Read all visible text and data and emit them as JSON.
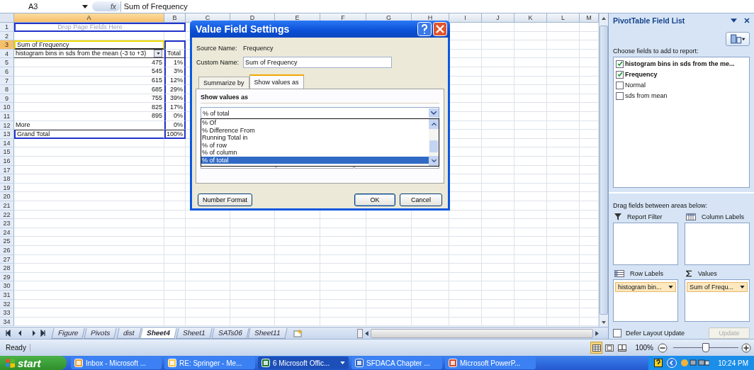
{
  "formula_bar": {
    "name_box": "A3",
    "fx_label": "fx",
    "formula": "Sum of Frequency"
  },
  "sheet": {
    "columns": [
      {
        "label": "A",
        "selected": true
      },
      {
        "label": "B",
        "selected": false
      },
      {
        "label": "C",
        "selected": false
      },
      {
        "label": "D",
        "selected": false
      },
      {
        "label": "E",
        "selected": false
      },
      {
        "label": "F",
        "selected": false
      },
      {
        "label": "G",
        "selected": false
      },
      {
        "label": "H",
        "selected": false
      },
      {
        "label": "I",
        "selected": false
      },
      {
        "label": "J",
        "selected": false
      },
      {
        "label": "K",
        "selected": false
      },
      {
        "label": "L",
        "selected": false
      },
      {
        "label": "M",
        "selected": false
      }
    ],
    "rows": [
      {
        "label": "1",
        "selected": false
      },
      {
        "label": "2",
        "selected": false
      },
      {
        "label": "3",
        "selected": true
      },
      {
        "label": "4",
        "selected": false
      },
      {
        "label": "5",
        "selected": false
      },
      {
        "label": "6",
        "selected": false
      },
      {
        "label": "7",
        "selected": false
      },
      {
        "label": "8",
        "selected": false
      },
      {
        "label": "9",
        "selected": false
      },
      {
        "label": "10",
        "selected": false
      },
      {
        "label": "11",
        "selected": false
      },
      {
        "label": "12",
        "selected": false
      },
      {
        "label": "13",
        "selected": false
      },
      {
        "label": "14",
        "selected": false
      },
      {
        "label": "15",
        "selected": false
      },
      {
        "label": "16",
        "selected": false
      },
      {
        "label": "17",
        "selected": false
      },
      {
        "label": "18",
        "selected": false
      },
      {
        "label": "19",
        "selected": false
      },
      {
        "label": "20",
        "selected": false
      },
      {
        "label": "21",
        "selected": false
      },
      {
        "label": "22",
        "selected": false
      },
      {
        "label": "23",
        "selected": false
      },
      {
        "label": "24",
        "selected": false
      },
      {
        "label": "25",
        "selected": false
      },
      {
        "label": "26",
        "selected": false
      },
      {
        "label": "27",
        "selected": false
      },
      {
        "label": "28",
        "selected": false
      },
      {
        "label": "29",
        "selected": false
      },
      {
        "label": "30",
        "selected": false
      },
      {
        "label": "31",
        "selected": false
      },
      {
        "label": "32",
        "selected": false
      },
      {
        "label": "33",
        "selected": false
      },
      {
        "label": "34",
        "selected": false
      }
    ]
  },
  "pivot": {
    "drop_zone": "Drop Page Fields Here",
    "data_field": "Sum of Frequency",
    "row_field": "histogram bins in sds from the mean (-3 to +3)",
    "total_header": "Total",
    "rows": [
      {
        "label": "475",
        "value": "1%",
        "kind": "number"
      },
      {
        "label": "545",
        "value": "3%",
        "kind": "number"
      },
      {
        "label": "615",
        "value": "12%",
        "kind": "number"
      },
      {
        "label": "685",
        "value": "29%",
        "kind": "number"
      },
      {
        "label": "755",
        "value": "39%",
        "kind": "number"
      },
      {
        "label": "825",
        "value": "17%",
        "kind": "number"
      },
      {
        "label": "895",
        "value": "0%",
        "kind": "number"
      },
      {
        "label": "More",
        "value": "0%",
        "kind": "text"
      }
    ],
    "grand_total": {
      "label": "Grand Total",
      "value": "100%"
    }
  },
  "sheet_tabs": [
    {
      "label": "Figure",
      "selected": false
    },
    {
      "label": "Pivots",
      "selected": false
    },
    {
      "label": "dist",
      "selected": false
    },
    {
      "label": "Sheet4",
      "selected": true
    },
    {
      "label": "Sheet1",
      "selected": false
    },
    {
      "label": "SATs06",
      "selected": false
    },
    {
      "label": "Sheet11",
      "selected": false
    }
  ],
  "dialog": {
    "title": "Value Field Settings",
    "source_label": "Source Name:",
    "source_value": "Frequency",
    "custom_label": "Custom Name:",
    "custom_value": "Sum of Frequency",
    "tabs": [
      {
        "label": "Summarize by",
        "selected": false
      },
      {
        "label": "Show values as",
        "selected": true
      }
    ],
    "section_title": "Show values as",
    "dropdown": {
      "value": "% of total",
      "expanded": true,
      "options": [
        {
          "label": "% Of",
          "selected": false
        },
        {
          "label": "% Difference From",
          "selected": false
        },
        {
          "label": "Running Total in",
          "selected": false
        },
        {
          "label": "% of row",
          "selected": false
        },
        {
          "label": "% of column",
          "selected": false
        },
        {
          "label": "% of total",
          "selected": true
        }
      ]
    },
    "buttons": [
      {
        "label": "Number Format",
        "kind": "secondary"
      },
      {
        "label": "OK",
        "kind": "default"
      },
      {
        "label": "Cancel",
        "kind": "secondary"
      }
    ]
  },
  "field_list": {
    "title": "PivotTable Field List",
    "choose_label": "Choose fields to add to report:",
    "fields": [
      {
        "label": "histogram bins in sds from the me...",
        "checked": true
      },
      {
        "label": "Frequency",
        "checked": true
      },
      {
        "label": "Normal",
        "checked": false
      },
      {
        "label": "sds from mean",
        "checked": false
      }
    ],
    "drag_label": "Drag fields between areas below:",
    "areas": [
      {
        "label": "Report Filter",
        "kind": "filter"
      },
      {
        "label": "Column Labels",
        "kind": "columns"
      },
      {
        "label": "Row Labels",
        "kind": "rows",
        "item": "histogram bin..."
      },
      {
        "label": "Values",
        "kind": "values",
        "item": "Sum of Frequ..."
      }
    ],
    "defer_update": {
      "label": "Defer Layout Update",
      "checked": false
    },
    "update_button": {
      "label": "Update",
      "disabled": true
    }
  },
  "status_bar": {
    "text": "Ready",
    "views": [
      {
        "kind": "normal",
        "selected": true
      },
      {
        "kind": "layout",
        "selected": false
      },
      {
        "kind": "break",
        "selected": false
      }
    ],
    "zoom": {
      "label": "100%",
      "level": 0.5
    }
  },
  "taskbar": {
    "start": "start",
    "tasks": [
      {
        "label": "Inbox - Microsoft ...",
        "kind": "outlook",
        "selected": false
      },
      {
        "label": "RE: Springer - Me...",
        "kind": "mail",
        "selected": false
      },
      {
        "label": "6 Microsoft Offic...",
        "kind": "excel",
        "selected": true
      },
      {
        "label": "SFDACA Chapter ...",
        "kind": "word",
        "selected": false
      },
      {
        "label": "Microsoft PowerP...",
        "kind": "powerpoint",
        "selected": false
      }
    ],
    "clock": "10:24 PM"
  }
}
